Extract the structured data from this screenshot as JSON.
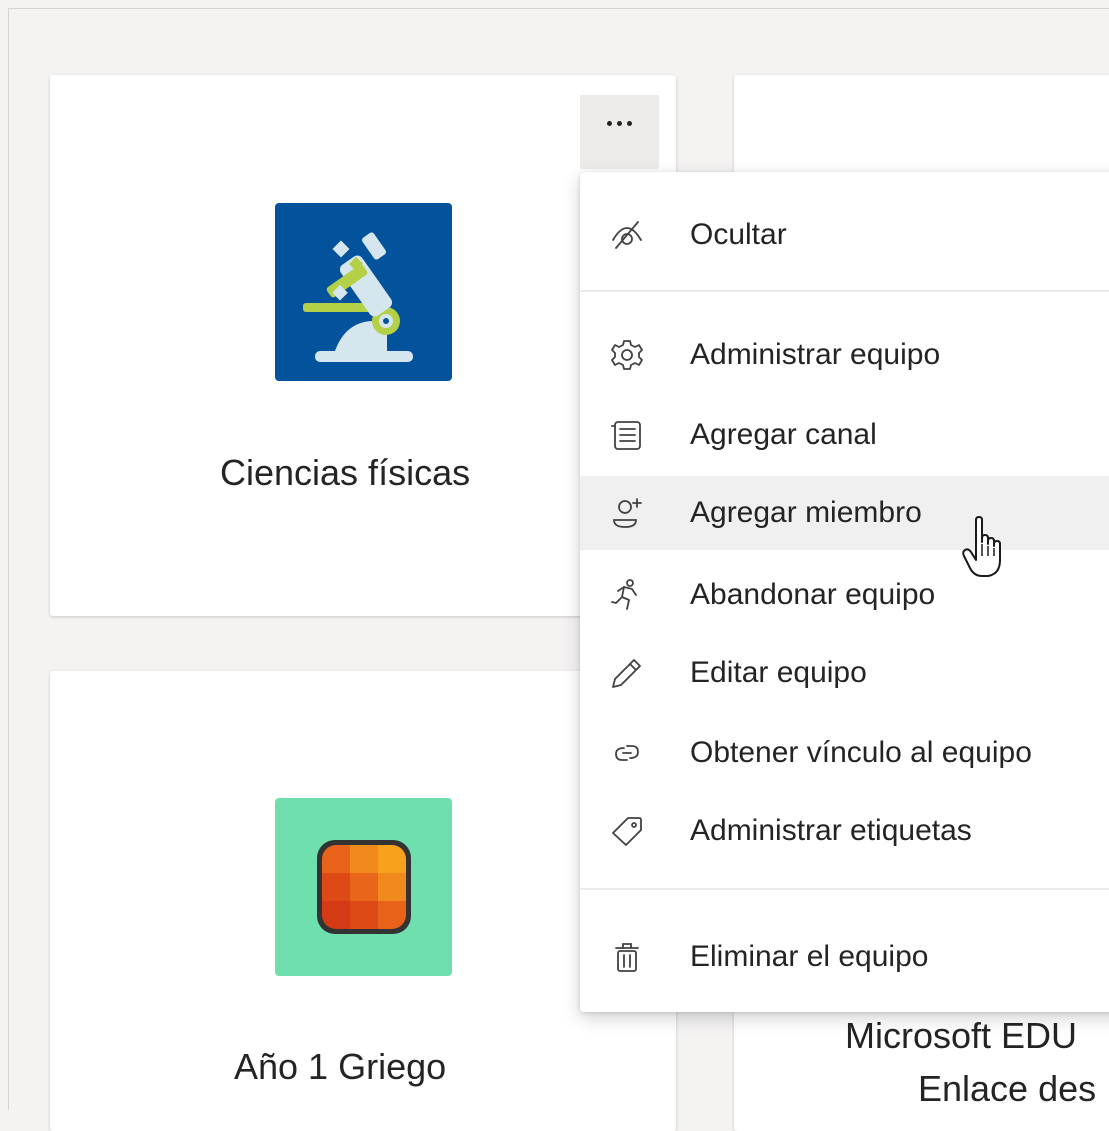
{
  "teams": [
    {
      "name": "Ciencias físicas",
      "icon": "microscope-icon",
      "icon_bg": "#03539c"
    },
    {
      "name": "Año 1 Griego",
      "icon": "tile-grid-icon",
      "icon_bg": "#6fdfad"
    },
    {
      "name_line1": "Microsoft EDU",
      "name_line2": "Enlace des"
    }
  ],
  "more_button": {
    "icon": "more-horizontal-icon"
  },
  "menu": {
    "items": [
      {
        "label": "Ocultar",
        "icon": "eye-hide-icon"
      },
      {
        "label": "Administrar equipo",
        "icon": "gear-icon"
      },
      {
        "label": "Agregar canal",
        "icon": "channel-list-icon"
      },
      {
        "label": "Agregar miembro",
        "icon": "add-person-icon",
        "state": "hover"
      },
      {
        "label": "Abandonar equipo",
        "icon": "leave-runner-icon"
      },
      {
        "label": "Editar equipo",
        "icon": "pencil-icon"
      },
      {
        "label": "Obtener vínculo al equipo",
        "icon": "link-icon"
      },
      {
        "label": "Administrar etiquetas",
        "icon": "tag-icon"
      },
      {
        "label": "Eliminar el equipo",
        "icon": "trash-icon"
      }
    ]
  },
  "colors": {
    "accent_blue": "#03539c",
    "mint": "#6fdfad",
    "hover": "#f0f0f0"
  }
}
